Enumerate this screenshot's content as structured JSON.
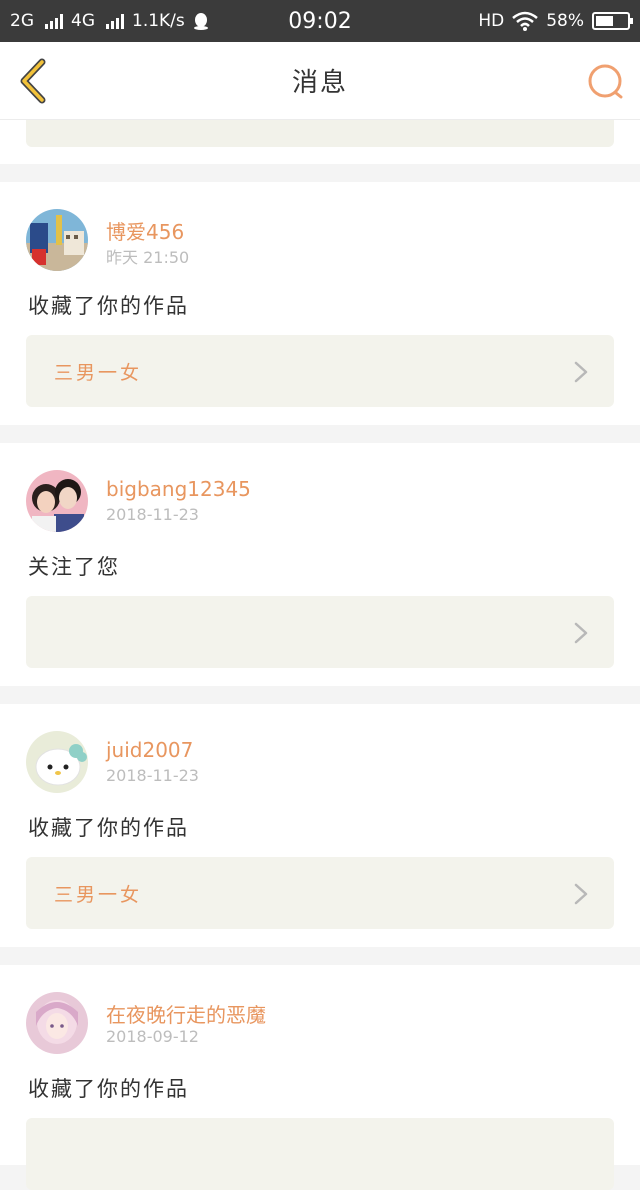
{
  "status_bar": {
    "network1": "2G",
    "network2": "4G",
    "speed": "1.1K/s",
    "time": "09:02",
    "hd": "HD",
    "battery_percent": "58%",
    "battery_level": 0.58
  },
  "nav": {
    "title": "消息"
  },
  "messages": [
    {
      "username": "博爱456",
      "time": "昨天 21:50",
      "action": "收藏了你的作品",
      "work_title": "三男一女"
    },
    {
      "username": "bigbang12345",
      "time": "2018-11-23",
      "action": "关注了您",
      "work_title": ""
    },
    {
      "username": "juid2007",
      "time": "2018-11-23",
      "action": "收藏了你的作品",
      "work_title": "三男一女"
    },
    {
      "username": "在夜晚行走的恶魔",
      "time": "2018-09-12",
      "action": "收藏了你的作品",
      "work_title": ""
    }
  ],
  "colors": {
    "accent": "#e8965f",
    "box_bg": "#f3f3ec"
  }
}
